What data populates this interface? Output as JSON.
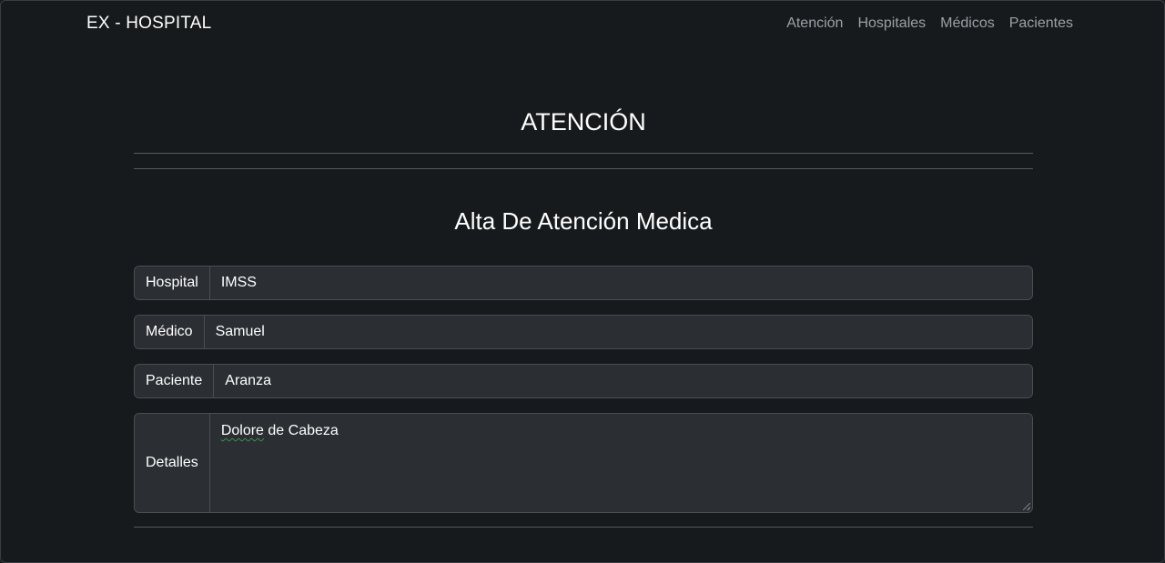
{
  "navbar": {
    "brand": "EX - HOSPITAL",
    "links": [
      "Atención",
      "Hospitales",
      "Médicos",
      "Pacientes"
    ]
  },
  "page": {
    "title": "ATENCIÓN",
    "section_title": "Alta De Atención Medica"
  },
  "form": {
    "hospital": {
      "label": "Hospital",
      "value": "IMSS"
    },
    "medico": {
      "label": "Médico",
      "value": "Samuel"
    },
    "paciente": {
      "label": "Paciente",
      "value": "Aranza"
    },
    "detalles": {
      "label": "Detalles",
      "value_first_word": "Dolore",
      "value_rest": " de Cabeza"
    }
  },
  "colors": {
    "background": "#171a1c",
    "input_background": "#2b2e33",
    "border": "#4a4e53",
    "nav_link": "#9ca0a5"
  }
}
